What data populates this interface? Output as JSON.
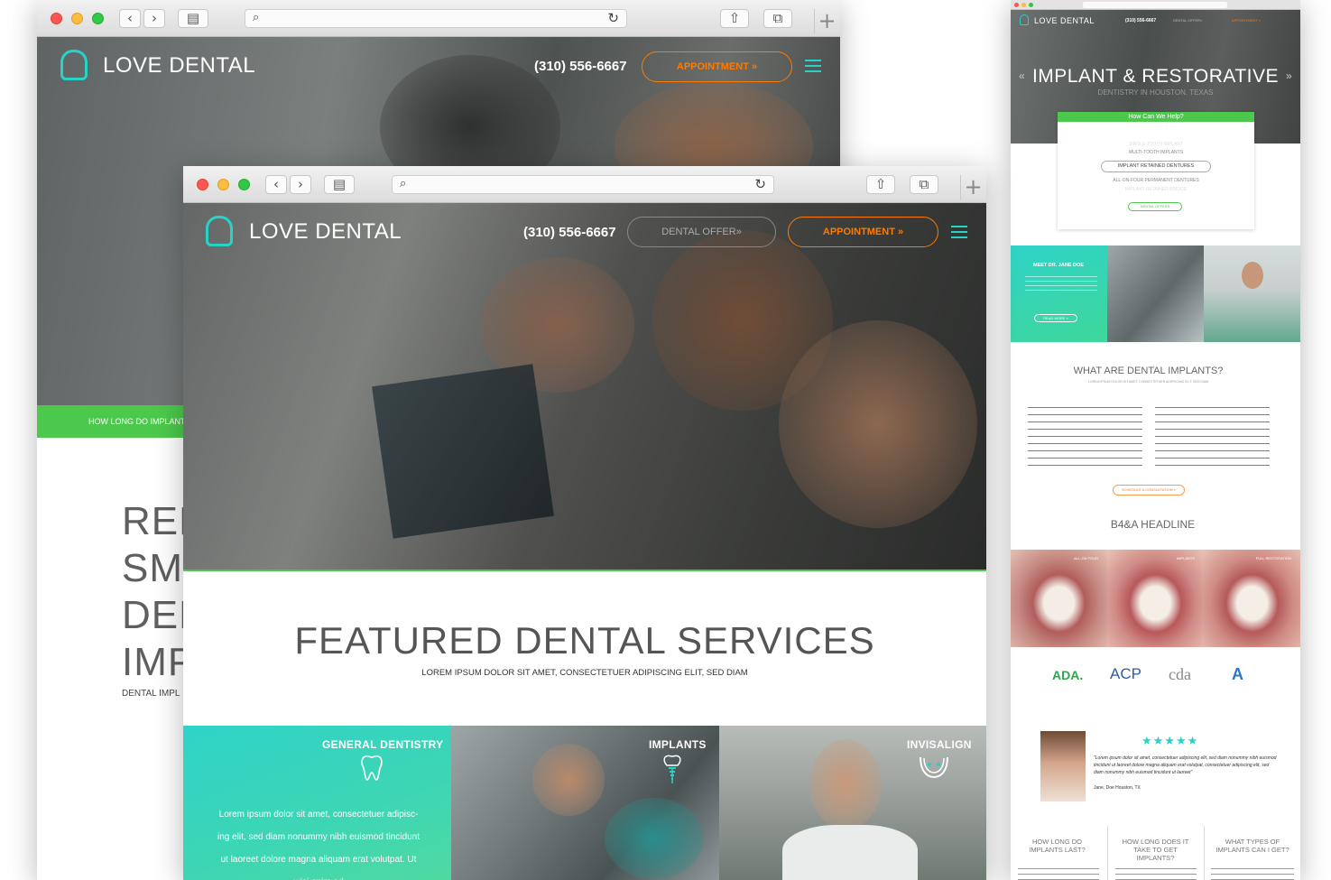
{
  "brand": {
    "name": "LOVE DENTAL",
    "phone": "(310) 556-6667",
    "accent": "#27d3c6",
    "cta": "#ff7a00",
    "green": "#4cc94c"
  },
  "back_window": {
    "appointment_label": "APPOINTMENT »",
    "green_bar_text": "HOW LONG DO IMPLANTS",
    "headline_lines": [
      "REF",
      "SM",
      "DEN",
      "IMP"
    ],
    "subline": "DENTAL IMPL"
  },
  "front_window": {
    "dental_offer_label": "DENTAL OFFER»",
    "appointment_label": "APPOINTMENT »",
    "featured_title": "FEATURED DENTAL SERVICES",
    "featured_sub": "LOREM IPSUM DOLOR SIT AMET, CONSECTETUER ADIPISCING ELIT, SED DIAM",
    "services": [
      {
        "title": "GENERAL DENTISTRY",
        "icon": "tooth-icon"
      },
      {
        "title": "IMPLANTS",
        "icon": "implant-icon"
      },
      {
        "title": "INVISALIGN",
        "icon": "aligner-icon"
      }
    ],
    "service_body": [
      "Lorem ipsum dolor sit amet, consectetuer adipisc-",
      "ing elit, sed diam nonummy nibh euismod tincidunt",
      "ut laoreet dolore magna aliquam erat volutpat. Ut",
      "wisi enim ad"
    ]
  },
  "right_window": {
    "nav_phone": "(310) 556-6667",
    "nav_offer": "DENTAL OFFER»",
    "nav_appt": "APPOINTMENT »",
    "hero_title": "IMPLANT & RESTORATIVE",
    "hero_sub": "DENTISTRY IN HOUSTON, TEXAS",
    "help_title": "How Can We Help?",
    "help_items": [
      "SINGLE TOOTH IMPLANT",
      "MULTI-TOOTH IMPLANTS",
      "IMPLANT RETAINED DENTURES",
      "ALL-ON-FOUR PERMANENT DENTURES",
      "IMPLANT RETAINED BRIDGE"
    ],
    "help_button": "DENTAL OFFERS",
    "meet_title": "MEET DR. JANE DOE",
    "read_more": "READ MORE »",
    "what_title": "WHAT ARE DENTAL IMPLANTS?",
    "what_sub": "LOREM IPSUM DOLOR SIT AMET, CONSECTETUER ADIPISCING ELIT, SED DIAM",
    "consult_button": "SCHEDULE A CONSULTATION »",
    "ba_title": "B4&A HEADLINE",
    "ba_labels": [
      "ALL-ON FOUR",
      "IMPLANTS",
      "FULL RESTORATION"
    ],
    "assoc_logos": [
      "ADA.",
      "ACP",
      "cda",
      "A"
    ],
    "stars": "★★★★★",
    "testimonial": "\"Lorem ipsum dolor sit amet, consectetuer adipiscing elit, sed diam nonummy nibh euismod tincidunt ut laoreet dolore magna aliquam erat volutpat, consectetuer adipiscing elit, sed diam nonummy nibh euismod tincidunt ut laoreet\"",
    "testimonial_author": "Jane, Doe Houston, TX",
    "faq": [
      "HOW LONG DO IMPLANTS LAST?",
      "HOW LONG DOES IT TAKE TO GET IMPLANTS?",
      "WHAT TYPES OF IMPLANTS CAN I GET?"
    ]
  }
}
